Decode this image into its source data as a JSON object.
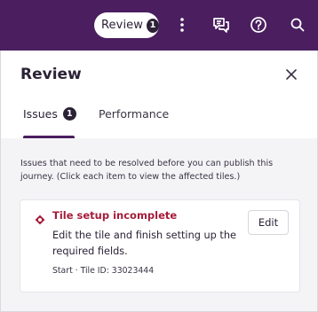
{
  "header": {
    "review_label": "Review",
    "review_count": "1",
    "icons": [
      "more-vert-icon",
      "chat-bubbles-icon",
      "help-icon",
      "search-icon"
    ]
  },
  "panel": {
    "title": "Review",
    "tabs": [
      {
        "label": "Issues",
        "count": "1",
        "active": true
      },
      {
        "label": "Performance",
        "active": false
      }
    ],
    "description": "Issues that need to be resolved before you can publish this journey. (Click each item to view the affected tiles.)",
    "issues": [
      {
        "title": "Tile setup incomplete",
        "body": "Edit the tile and finish setting up the required fields.",
        "meta": "Start · Tile ID: 33023444",
        "action_label": "Edit"
      }
    ]
  },
  "colors": {
    "header_bg": "#4a1e5f",
    "accent": "#4a1e5f",
    "error": "#a51c3a"
  }
}
